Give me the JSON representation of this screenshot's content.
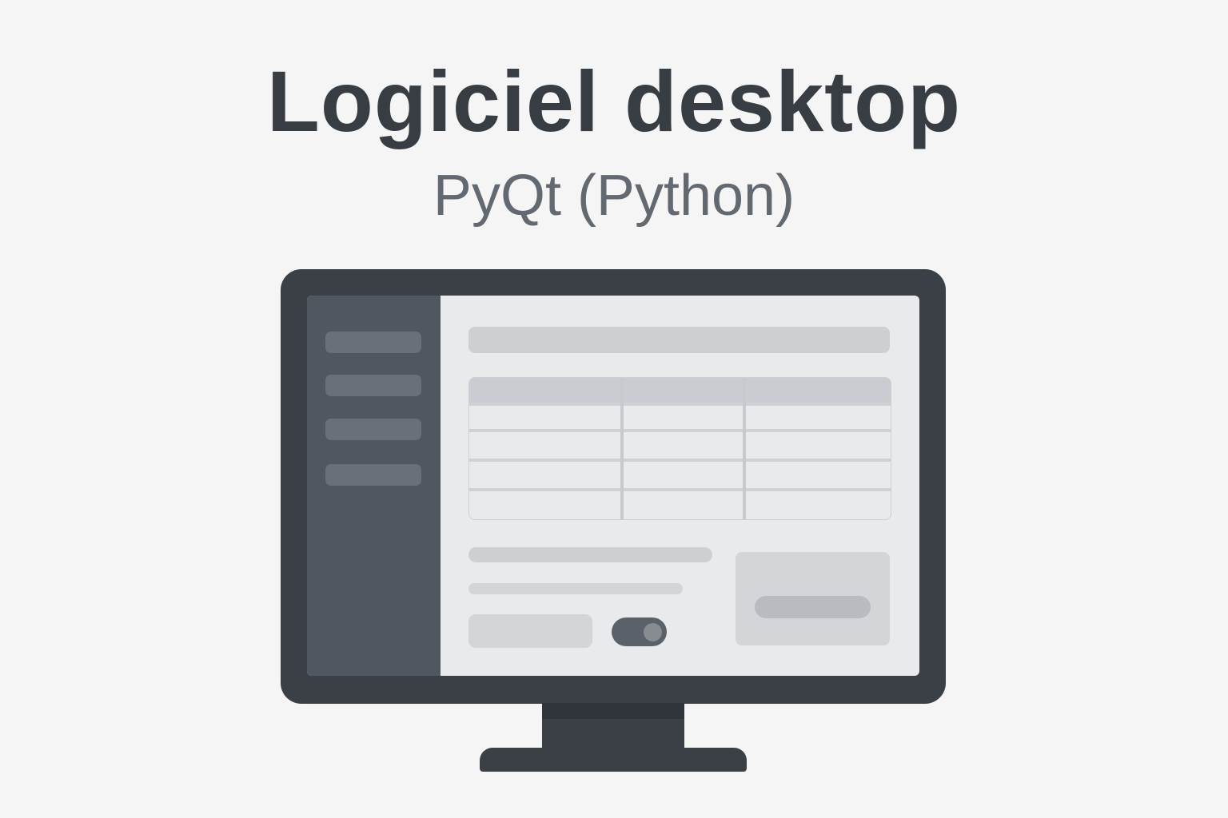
{
  "header": {
    "title": "Logiciel desktop",
    "subtitle": "PyQt (Python)"
  },
  "illustration": {
    "device": "desktop-monitor",
    "sidebar_item_count": 4,
    "table_columns": 3,
    "table_rows": 4,
    "toggle_state": "on"
  },
  "colors": {
    "background": "#f5f5f5",
    "title": "#373d43",
    "subtitle": "#626970",
    "monitor_frame": "#3a4046",
    "sidebar": "#50575e",
    "screen": "#e9eaeb"
  }
}
